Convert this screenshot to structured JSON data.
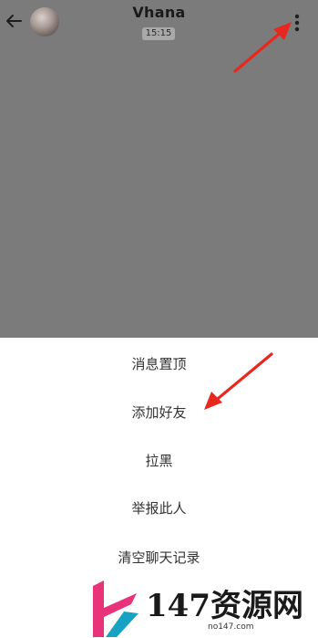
{
  "header": {
    "contact_name": "Vhana",
    "time": "15:15"
  },
  "menu": {
    "items": [
      "消息置顶",
      "添加好友",
      "拉黑",
      "举报此人",
      "清空聊天记录"
    ]
  },
  "watermark": {
    "text": "147资源网",
    "url": "no147.com"
  },
  "icons": {
    "back": "arrow-left-icon",
    "more": "more-vertical-icon"
  },
  "colors": {
    "overlay": "#7b7b7b",
    "annotation_arrow": "#e8281e",
    "logo_pink": "#e8327a",
    "logo_teal": "#17a2c4"
  }
}
